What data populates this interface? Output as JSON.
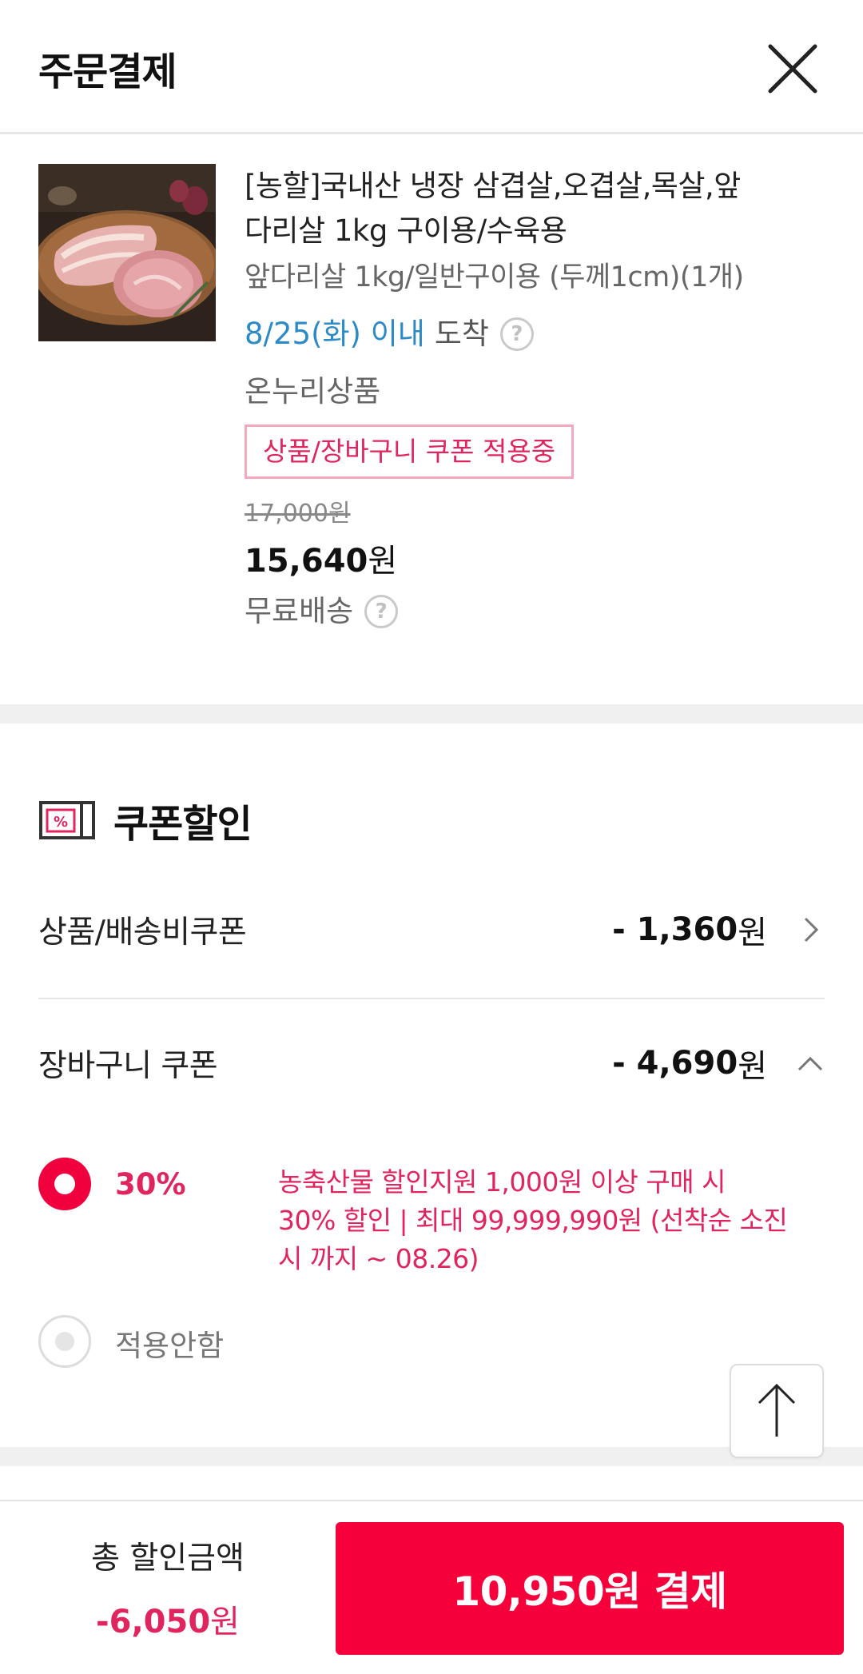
{
  "header": {
    "title": "주문결제",
    "close_icon": "close-icon"
  },
  "product": {
    "name_line1": "[농할]국내산 냉장 삼겹살,오겹살,목살,앞",
    "name_line2": "다리살 1kg 구이용/수육용",
    "option": "앞다리살 1kg/일반구이용 (두께1cm)(1개)",
    "delivery_date": "8/25(화) 이내",
    "delivery_suffix": "도착",
    "onnuri": "온누리상품",
    "coupon_badge": "상품/장바구니 쿠폰 적용중",
    "original_price": "17,000원",
    "sale_price_num": "15,640",
    "sale_price_unit": "원",
    "shipping": "무료배송",
    "help_glyph": "?"
  },
  "coupon": {
    "title": "쿠폰할인",
    "item_coupon": {
      "label": "상품/배송비쿠폰",
      "amount": "- 1,360",
      "unit": "원"
    },
    "cart_coupon": {
      "label": "장바구니 쿠폰",
      "amount": "- 4,690",
      "unit": "원"
    },
    "options": [
      {
        "percent": "30%",
        "desc_line1": "농축산물 할인지원 1,000원 이상 구매 시",
        "desc_line2": "30% 할인 | 최대 99,999,990원 (선착순 소진",
        "desc_line3": "시 까지 ~ 08.26)",
        "selected": true
      },
      {
        "label": "적용안함",
        "selected": false
      }
    ]
  },
  "footer": {
    "total_label": "총 할인금액",
    "total_amount_num": "-6,050",
    "total_amount_unit": "원",
    "pay_button": "10,950원 결제"
  },
  "colors": {
    "accent": "#f6003c",
    "coupon_text": "#e0245e",
    "delivery_blue": "#2b8ac7"
  }
}
